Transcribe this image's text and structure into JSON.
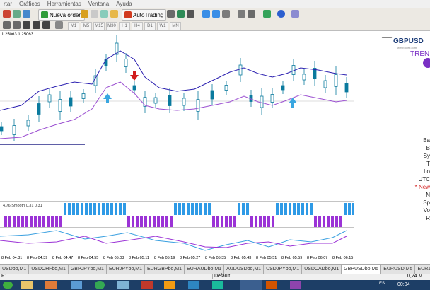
{
  "menu": {
    "items": [
      "rtar",
      "Gráficos",
      "Herramientas",
      "Ventana",
      "Ayuda"
    ]
  },
  "toolbar": {
    "new_order": "Nueva orden",
    "autotrading": "AutoTrading"
  },
  "timeframes": [
    "M1",
    "M5",
    "M15",
    "M30",
    "H1",
    "H4",
    "D1",
    "W1",
    "MN"
  ],
  "chart": {
    "price_label": "1.25063 1.25063",
    "indicator_label": "4.76 Smooth 0.31 0.31",
    "time_labels": [
      "8 Feb 04:31",
      "8 Feb 04:39",
      "8 Feb 04:47",
      "8 Feb 04:55",
      "8 Feb 05:03",
      "8 Feb 05:11",
      "8 Feb 05:19",
      "8 Feb 05:27",
      "8 Feb 05:35",
      "8 Feb 05:43",
      "8 Feb 05:51",
      "8 Feb 05:59",
      "8 Feb 06:07",
      "8 Feb 06:15"
    ],
    "colors": {
      "candle": "#0a7a9e",
      "bb_upper": "#2a1fb0",
      "bb_lower": "#9b4fd1",
      "bar_blue": "#2e9ae6",
      "bar_purple": "#9b33d6",
      "arrow_up": "#39a6e0",
      "arrow_down": "#d11c1c"
    }
  },
  "right_panel": {
    "logo": "GBPUSD",
    "site": "www.forex.com",
    "trend_label": "TREND",
    "labels": [
      "Ba",
      "B",
      "Sy",
      "T",
      "Lo",
      "UTC",
      "* New",
      "N",
      "Sp",
      "Vo",
      "R"
    ]
  },
  "tabs": [
    "USDbo,M1",
    "USDCHFbo,M1",
    "GBPJPYbo,M1",
    "EURJPYbo,M1",
    "EURGBPbo,M1",
    "EURAUDbo,M1",
    "AUDUSDbo,M1",
    "USDJPYbo,M1",
    "USDCADbo,M1",
    "GBPUSDbo,M5",
    "EURUSD,M5",
    "EURJ"
  ],
  "status": {
    "help": "F1",
    "profile": "Default",
    "speed": "0,24 M"
  },
  "taskbar": {
    "language": "ES",
    "clock": "00:04"
  }
}
